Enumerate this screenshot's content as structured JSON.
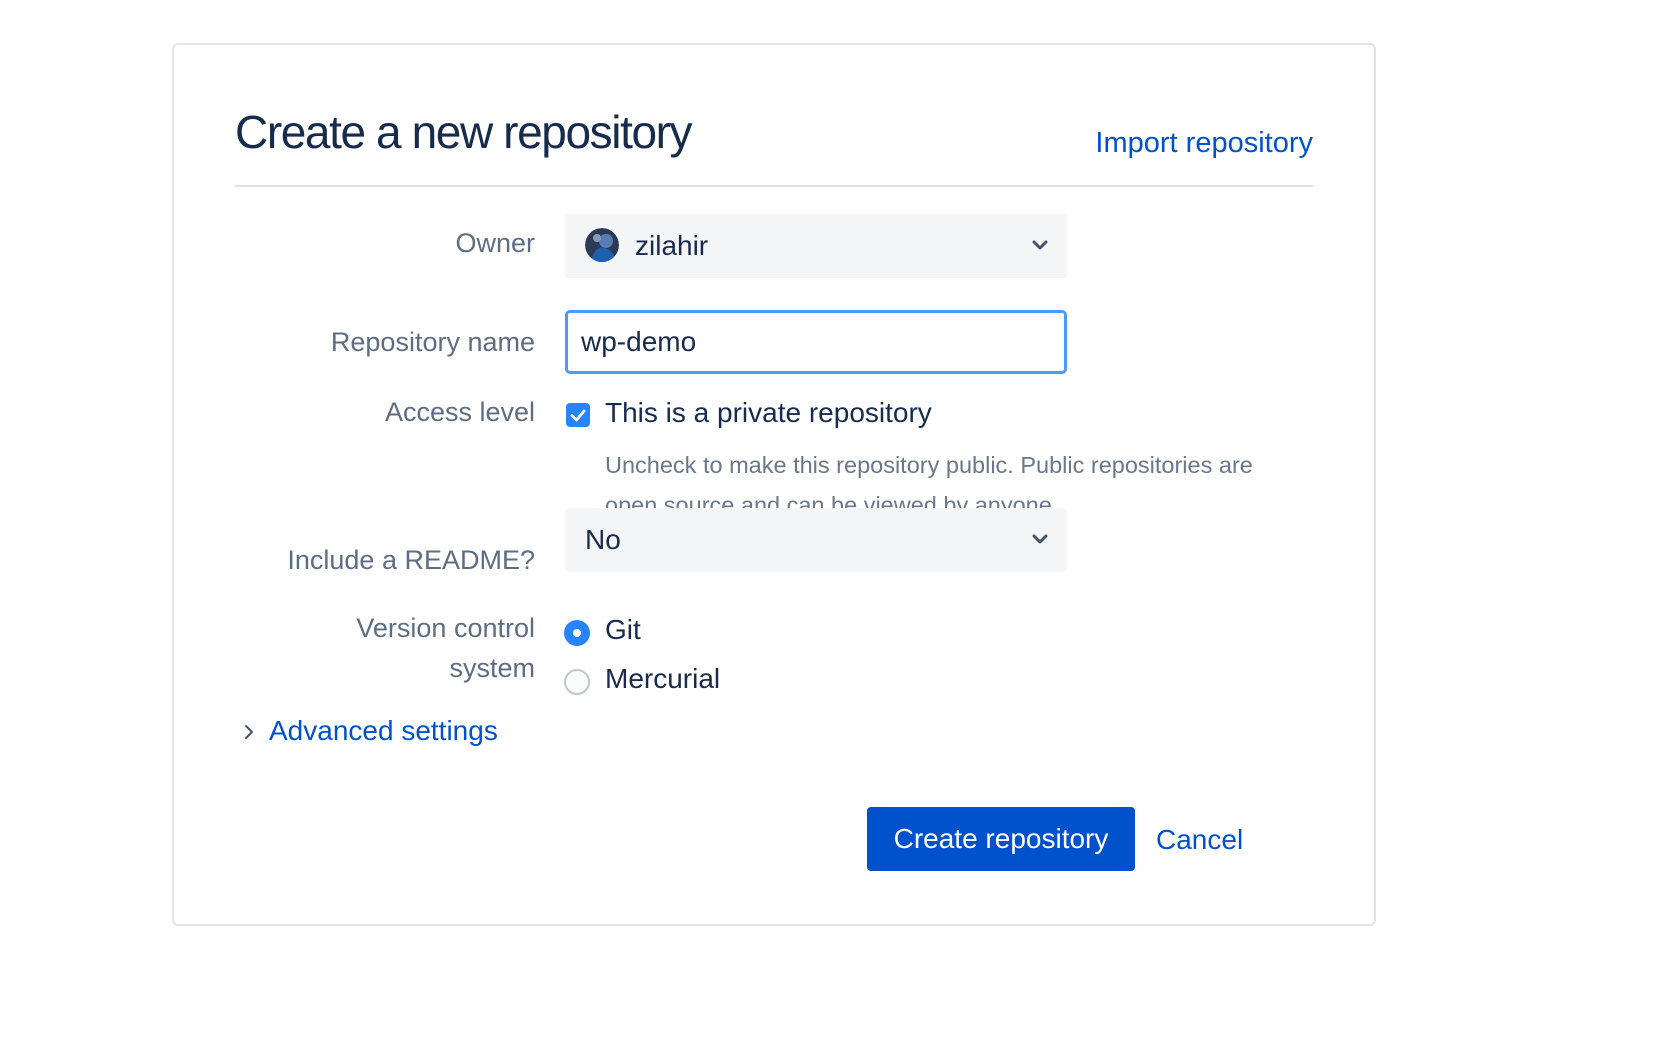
{
  "header": {
    "title": "Create a new repository",
    "import_link": "Import repository"
  },
  "form": {
    "owner": {
      "label": "Owner",
      "value": "zilahir",
      "avatar_icon": "user-avatar"
    },
    "repository_name": {
      "label": "Repository name",
      "required_marker": "*",
      "value": "wp-demo"
    },
    "access_level": {
      "label": "Access level",
      "checkbox_label": "This is a private repository",
      "checked": true,
      "help_text": "Uncheck to make this repository public. Public repositories are open source and can be viewed by anyone."
    },
    "readme": {
      "label": "Include a README?",
      "value": "No"
    },
    "vcs": {
      "label_line1": "Version control",
      "label_line2": "system",
      "options": [
        {
          "label": "Git",
          "selected": true
        },
        {
          "label": "Mercurial",
          "selected": false
        }
      ]
    },
    "advanced": {
      "label": "Advanced settings",
      "icon": "chevron-right-icon"
    }
  },
  "actions": {
    "create_label": "Create repository",
    "cancel_label": "Cancel"
  },
  "colors": {
    "primary": "#0052cc",
    "focus_border": "#4c9aff",
    "checkbox": "#2684ff",
    "required": "#de350b",
    "title": "#172b4d",
    "label": "#5e6c84"
  }
}
